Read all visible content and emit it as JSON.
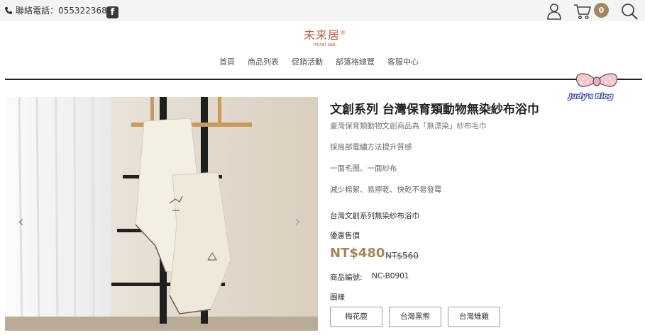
{
  "topbar": {
    "phone_text": "聯絡電話：055322368",
    "cart_count": "0"
  },
  "logo": {
    "main": "未来居",
    "mark": "®",
    "sub": "mirai lab."
  },
  "nav": {
    "items": [
      "首頁",
      "商品列表",
      "促銷活動",
      "部落格總覽",
      "客服中心"
    ]
  },
  "watermark": {
    "text": "Judy's Blog"
  },
  "product": {
    "title": "文創系列 台灣保育類動物無染紗布浴巾",
    "subtitle": "臺灣保育類動物文創商品為「無漂染」紗布毛巾",
    "features": [
      "採局部電繡方法提升質感",
      "一面毛圈、一面紗布",
      "減少棉絮、易擰乾、快乾不易發霉"
    ],
    "name": "台灣文創系列無染紗布浴巾",
    "price_label": "優惠售價",
    "price": "NT$480",
    "original_price": "NT$560",
    "sku_label": "商品編號:",
    "sku": "NC-B0901",
    "pattern_label": "圖樣",
    "patterns": [
      "梅花鹿",
      "台灣黑熊",
      "台灣雉雞"
    ]
  },
  "gallery": {
    "prev": "‹",
    "next": "›"
  },
  "colors": {
    "accent": "#a2865c",
    "logo": "#c85a47"
  }
}
